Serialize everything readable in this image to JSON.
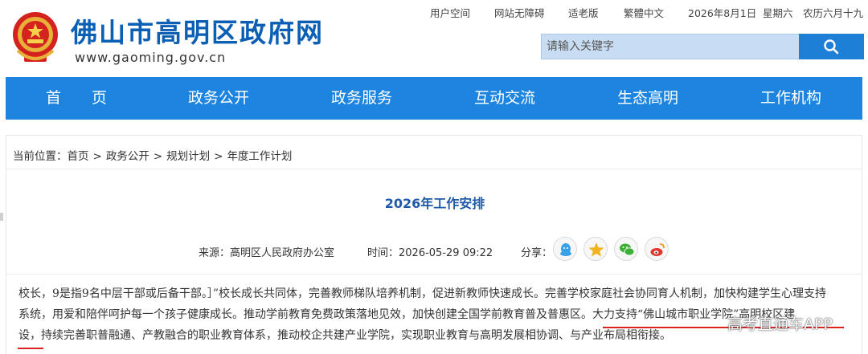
{
  "header": {
    "site_title": "佛山市高明区政府网",
    "site_url": "www.gaoming.gov.cn",
    "top_links": [
      "用户空间",
      "网站无障碍",
      "适老版",
      "繁體中文"
    ],
    "date": "2026年8月1日",
    "weekday": "星期六",
    "lunar": "农历六月十九",
    "search_placeholder": "请输入关键字",
    "brand_color": "#0b5fb4"
  },
  "nav": {
    "items": [
      "首　　页",
      "政务公开",
      "政务服务",
      "互动交流",
      "生态高明",
      "工作机构"
    ],
    "bg_color": "#1d85e0"
  },
  "breadcrumb": {
    "prefix": "当前位置：",
    "items": [
      "首页",
      "政务公开",
      "规划计划",
      "年度工作计划"
    ],
    "separator": ">"
  },
  "article": {
    "title": "2026年工作安排",
    "source_label": "来源：",
    "source": "高明区人民政府办公室",
    "time_label": "时间：",
    "time": "2026-05-29 09:22",
    "share_label": "分享：",
    "share_icons": [
      "qq-icon",
      "qzone-star-icon",
      "wechat-icon",
      "weibo-icon"
    ],
    "paragraph_lines": [
      "校长，9是指9名中层干部或后备干部。］”校长成长共同体，完善教师梯队培养机制，促进新教师快速成长。完善学校家庭社会协同育人机制，加快构建学生心理支持",
      "系统，用爱和陪伴呵护每一个孩子健康成长。推动学前教育免费政策落地见效，加快创建全国学前教育普及普惠区。大力支持“佛山城市职业学院”高明校区建",
      "设，持续完善职普融通、产教融合的职业教育体系，推动校企共建产业学院，实现职业教育与高明发展相协调、与产业布局相衔接。"
    ]
  },
  "watermark": "高考直通车APP"
}
